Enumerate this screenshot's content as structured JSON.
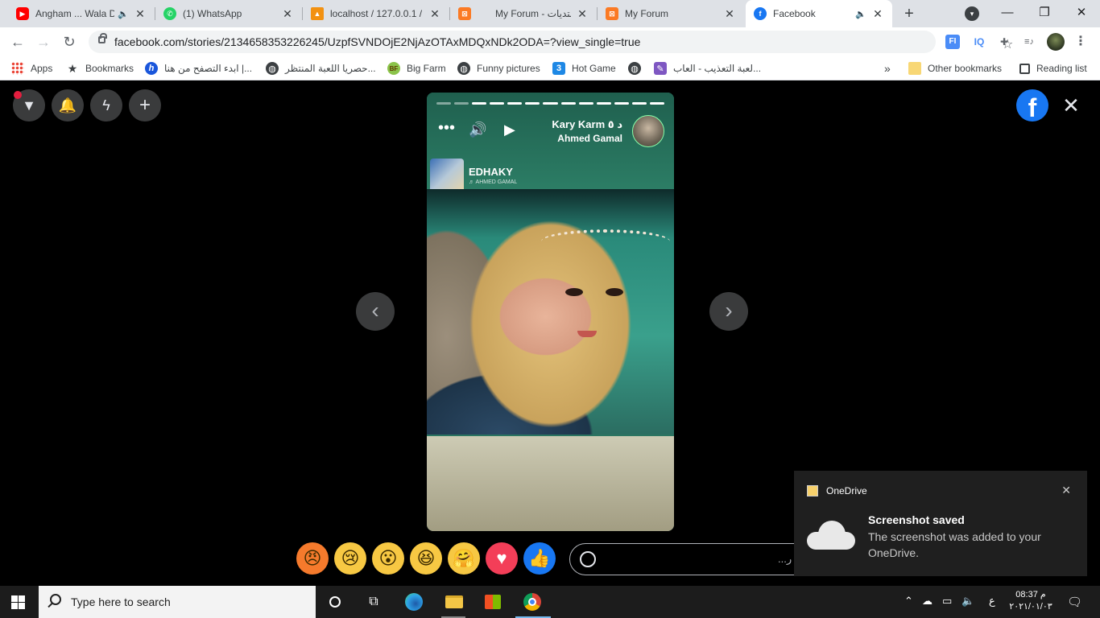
{
  "tabs": [
    {
      "title": "Angham ... Wala D",
      "favicon": "youtube-icon",
      "muted_icon": true,
      "color": "#ff0000"
    },
    {
      "title": "(1) WhatsApp",
      "favicon": "whatsapp-icon",
      "muted_icon": false,
      "color": "#25d366"
    },
    {
      "title": "localhost / 127.0.0.1 /",
      "favicon": "phpmyadmin-icon",
      "muted_icon": false,
      "color": "#f29111"
    },
    {
      "title": "My Forum - منتديات",
      "favicon": "xampp-icon",
      "muted_icon": false,
      "color": "#fb7a24"
    },
    {
      "title": "My Forum",
      "favicon": "xampp-icon",
      "muted_icon": false,
      "color": "#fb7a24"
    },
    {
      "title": "Facebook",
      "favicon": "facebook-icon",
      "muted_icon": true,
      "color": "#1877f2",
      "active": true
    }
  ],
  "tab_close_glyph": "✕",
  "newtab_glyph": "+",
  "window": {
    "minimize": "—",
    "restore": "❐",
    "close": "✕"
  },
  "address": {
    "url": "facebook.com/stories/2134658353226245/UzpfSVNDOjE2NjAzOTAxMDQxNDk2ODA=?view_single=true"
  },
  "extensions": [
    {
      "label": "FI",
      "name": "fi-extension-icon",
      "color": "#4a8cf7"
    },
    {
      "label": "IQ",
      "name": "iq-extension-icon",
      "color": "#4a8cf7"
    },
    {
      "label": "✚",
      "name": "puzzle-extensions-icon",
      "color": "#5f6368"
    },
    {
      "label": "≡♪",
      "name": "media-control-icon",
      "color": "#5f6368"
    }
  ],
  "bookmarks": [
    {
      "label": "Apps",
      "icon": "apps-grid-icon"
    },
    {
      "label": "Bookmarks",
      "icon": "star-icon"
    },
    {
      "label": "ابدء التصفح من هنا |...",
      "icon": "h-site-icon"
    },
    {
      "label": "حصريا اللعبة المنتظر...",
      "icon": "globe-icon"
    },
    {
      "label": "Big Farm",
      "icon": "bigfarm-icon"
    },
    {
      "label": "Funny pictures",
      "icon": "globe-icon"
    },
    {
      "label": "Hot Game",
      "icon": "game-icon"
    },
    {
      "label": "لعبة التعذيب - العاب...",
      "icon": "globe-icon"
    }
  ],
  "bookmarks_more": "»",
  "bookmarks_right": [
    {
      "label": "Other bookmarks",
      "icon": "folder-icon"
    },
    {
      "label": "Reading list",
      "icon": "reading-list-icon"
    }
  ],
  "story": {
    "progress_total": 13,
    "progress_done": 2,
    "author_line1": "Kary Karm د ٥",
    "author_line2": "Ahmed Gamal",
    "music_title": "EDHAKY",
    "music_artist": "♬ AHMED GAMAL"
  },
  "reply_placeholder": "...ر",
  "reactions": [
    {
      "name": "angry-reaction",
      "glyph": "😠",
      "color": "#f57a2c"
    },
    {
      "name": "sad-reaction",
      "glyph": "😢",
      "color": "#f7c843"
    },
    {
      "name": "wow-reaction",
      "glyph": "😮",
      "color": "#f7c843"
    },
    {
      "name": "haha-reaction",
      "glyph": "😆",
      "color": "#f7c843"
    },
    {
      "name": "care-reaction",
      "glyph": "🤗",
      "color": "#f7c843"
    },
    {
      "name": "love-reaction",
      "glyph": "♥",
      "color": "#f33e58"
    },
    {
      "name": "like-reaction",
      "glyph": "👍",
      "color": "#1877f2"
    }
  ],
  "toast": {
    "app": "OneDrive",
    "heading": "Screenshot saved",
    "body": "The screenshot was added to your OneDrive."
  },
  "taskbar": {
    "search_placeholder": "Type here to search",
    "time": "08:37 م",
    "date": "٢٠٢١/٠١/٠٣",
    "lang": "ع"
  }
}
